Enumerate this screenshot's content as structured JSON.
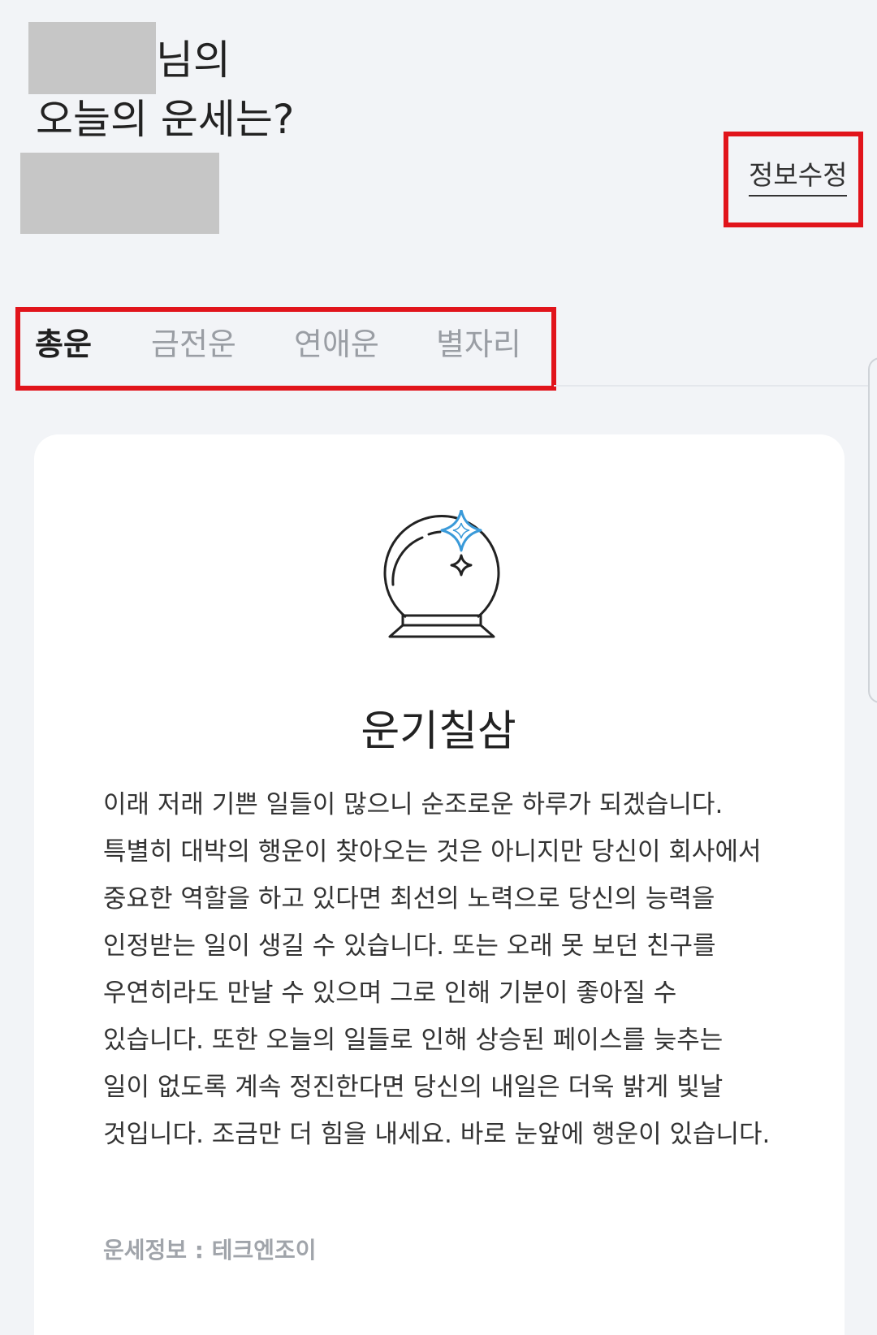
{
  "header": {
    "greeting_suffix": "님의",
    "greeting_question": "오늘의 운세는?",
    "edit_link": "정보수정"
  },
  "tabs": [
    {
      "label": "총운",
      "active": true
    },
    {
      "label": "금전운",
      "active": false
    },
    {
      "label": "연애운",
      "active": false
    },
    {
      "label": "별자리",
      "active": false
    }
  ],
  "card": {
    "icon": "crystal-ball-icon",
    "headline": "운기칠삼",
    "body": "이래 저래 기쁜 일들이 많으니 순조로운 하루가 되겠습니다. 특별히 대박의 행운이 찾아오는 것은 아니지만 당신이 회사에서 중요한 역할을 하고 있다면 최선의 노력으로 당신의 능력을 인정받는 일이 생길 수 있습니다. 또는 오래 못 보던 친구를 우연히라도 만날 수 있으며 그로 인해 기분이 좋아질 수 있습니다. 또한 오늘의 일들로 인해 상승된 페이스를 늦추는 일이 없도록 계속 정진한다면 당신의 내일은 더욱 밝게 빛날 것입니다. 조금만 더 힘을 내세요. 바로 눈앞에 행운이 있습니다.",
    "source": "운세정보 : 테크엔조이"
  },
  "colors": {
    "highlight_box": "#e1141b",
    "sparkle_accent": "#3a9ad9",
    "background": "#f2f4f7"
  }
}
